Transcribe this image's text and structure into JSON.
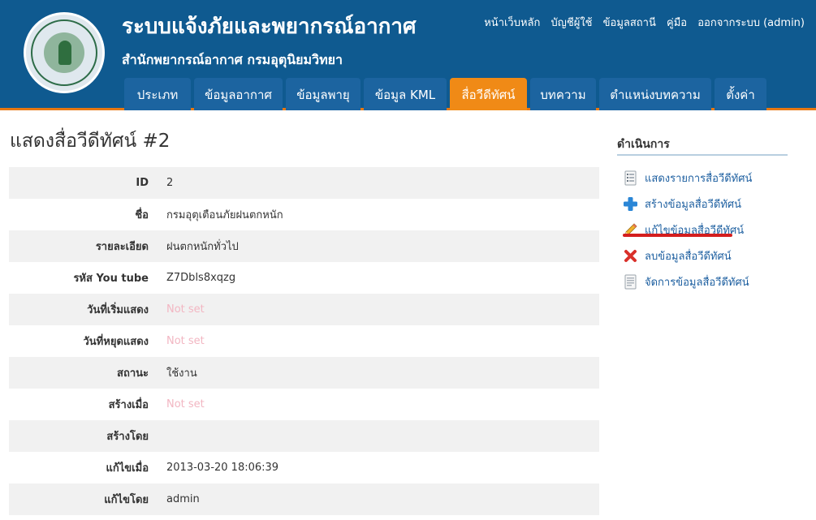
{
  "header": {
    "title": "ระบบแจ้งภัยและพยากรณ์อากาศ",
    "subtitle": "สำนักพยากรณ์อากาศ กรมอุตุนิยมวิทยา",
    "links": [
      "หน้าเว็บหลัก",
      "บัญชีผู้ใช้",
      "ข้อมูลสถานี",
      "คู่มือ",
      "ออกจากระบบ (admin)"
    ]
  },
  "nav": {
    "tabs": [
      "ประเภท",
      "ข้อมูลอากาศ",
      "ข้อมูลพายุ",
      "ข้อมูล KML",
      "สื่อวีดีทัศน์",
      "บทความ",
      "ตำแหน่งบทความ",
      "ตั้งค่า"
    ],
    "active": "สื่อวีดีทัศน์"
  },
  "page": {
    "title": "แสดงสื่อวีดีทัศน์ #2"
  },
  "details": [
    {
      "label": "ID",
      "value": "2"
    },
    {
      "label": "ชื่อ",
      "value": "กรมอุตุเตือนภัยฝนตกหนัก"
    },
    {
      "label": "รายละเอียด",
      "value": "ฝนตกหนักทั่วไป"
    },
    {
      "label": "รหัส You tube",
      "value": "Z7Dbls8xqzg"
    },
    {
      "label": "วันที่เริ่มแสดง",
      "value": "Not set"
    },
    {
      "label": "วันที่หยุดแสดง",
      "value": "Not set"
    },
    {
      "label": "สถานะ",
      "value": "ใช้งาน"
    },
    {
      "label": "สร้างเมื่อ",
      "value": "Not set"
    },
    {
      "label": "สร้างโดย",
      "value": ""
    },
    {
      "label": "แก้ไขเมื่อ",
      "value": "2013-03-20 18:06:39"
    },
    {
      "label": "แก้ไขโดย",
      "value": "admin"
    }
  ],
  "sidebar": {
    "title": "ดำเนินการ",
    "items": [
      {
        "label": "แสดงรายการสื่อวีดีทัศน์",
        "icon": "list-icon"
      },
      {
        "label": "สร้างข้อมูลสื่อวีดีทัศน์",
        "icon": "plus-icon"
      },
      {
        "label": "แก้ไขข้อมูลสื่อวีดีทัศน์",
        "icon": "pencil-icon"
      },
      {
        "label": "ลบข้อมูลสื่อวีดีทัศน์",
        "icon": "delete-icon"
      },
      {
        "label": "จัดการข้อมูลสื่อวีดีทัศน์",
        "icon": "document-icon"
      }
    ]
  },
  "colors": {
    "header_bg": "#0f5a90",
    "tab_bg": "#1c64a0",
    "tab_active": "#f08a16",
    "link": "#1d5fa0",
    "not_set": "#f2b6c2",
    "highlight_underline": "#d41e1e"
  }
}
